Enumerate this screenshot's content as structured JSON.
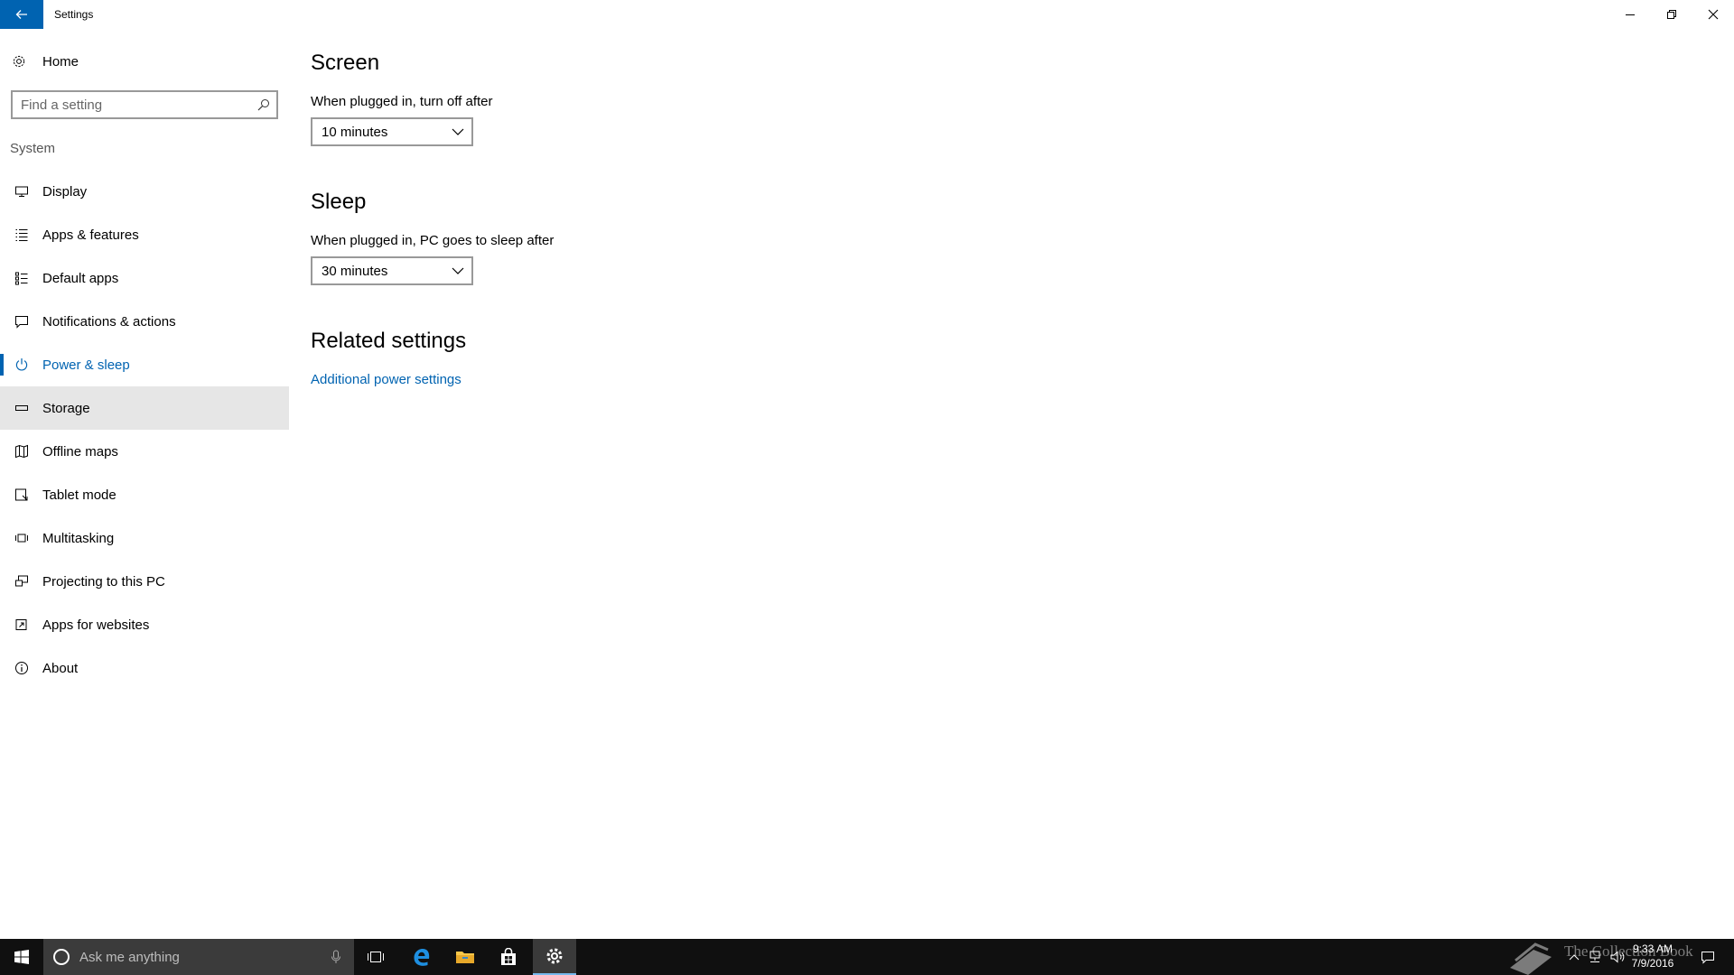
{
  "titlebar": {
    "title": "Settings"
  },
  "sidebar": {
    "home_label": "Home",
    "search_placeholder": "Find a setting",
    "section": "System",
    "items": [
      {
        "label": "Display",
        "icon": "display-icon"
      },
      {
        "label": "Apps & features",
        "icon": "apps-list-icon"
      },
      {
        "label": "Default apps",
        "icon": "default-apps-icon"
      },
      {
        "label": "Notifications & actions",
        "icon": "notifications-icon"
      },
      {
        "label": "Power & sleep",
        "icon": "power-icon",
        "state": "selected"
      },
      {
        "label": "Storage",
        "icon": "storage-icon",
        "state": "hover"
      },
      {
        "label": "Offline maps",
        "icon": "map-icon"
      },
      {
        "label": "Tablet mode",
        "icon": "tablet-icon"
      },
      {
        "label": "Multitasking",
        "icon": "multitasking-icon"
      },
      {
        "label": "Projecting to this PC",
        "icon": "projecting-icon"
      },
      {
        "label": "Apps for websites",
        "icon": "apps-websites-icon"
      },
      {
        "label": "About",
        "icon": "info-icon"
      }
    ]
  },
  "main": {
    "screen": {
      "heading": "Screen",
      "label": "When plugged in, turn off after",
      "value": "10 minutes"
    },
    "sleep": {
      "heading": "Sleep",
      "label": "When plugged in, PC goes to sleep after",
      "value": "30 minutes"
    },
    "related": {
      "heading": "Related settings",
      "link": "Additional power settings"
    }
  },
  "taskbar": {
    "search_text": "Ask me anything",
    "time": "9:33 AM",
    "date": "7/9/2016",
    "watermark": "The Collection Book"
  },
  "colors": {
    "accent": "#0063b1",
    "taskbar": "#101010",
    "hover": "#e6e6e6"
  }
}
